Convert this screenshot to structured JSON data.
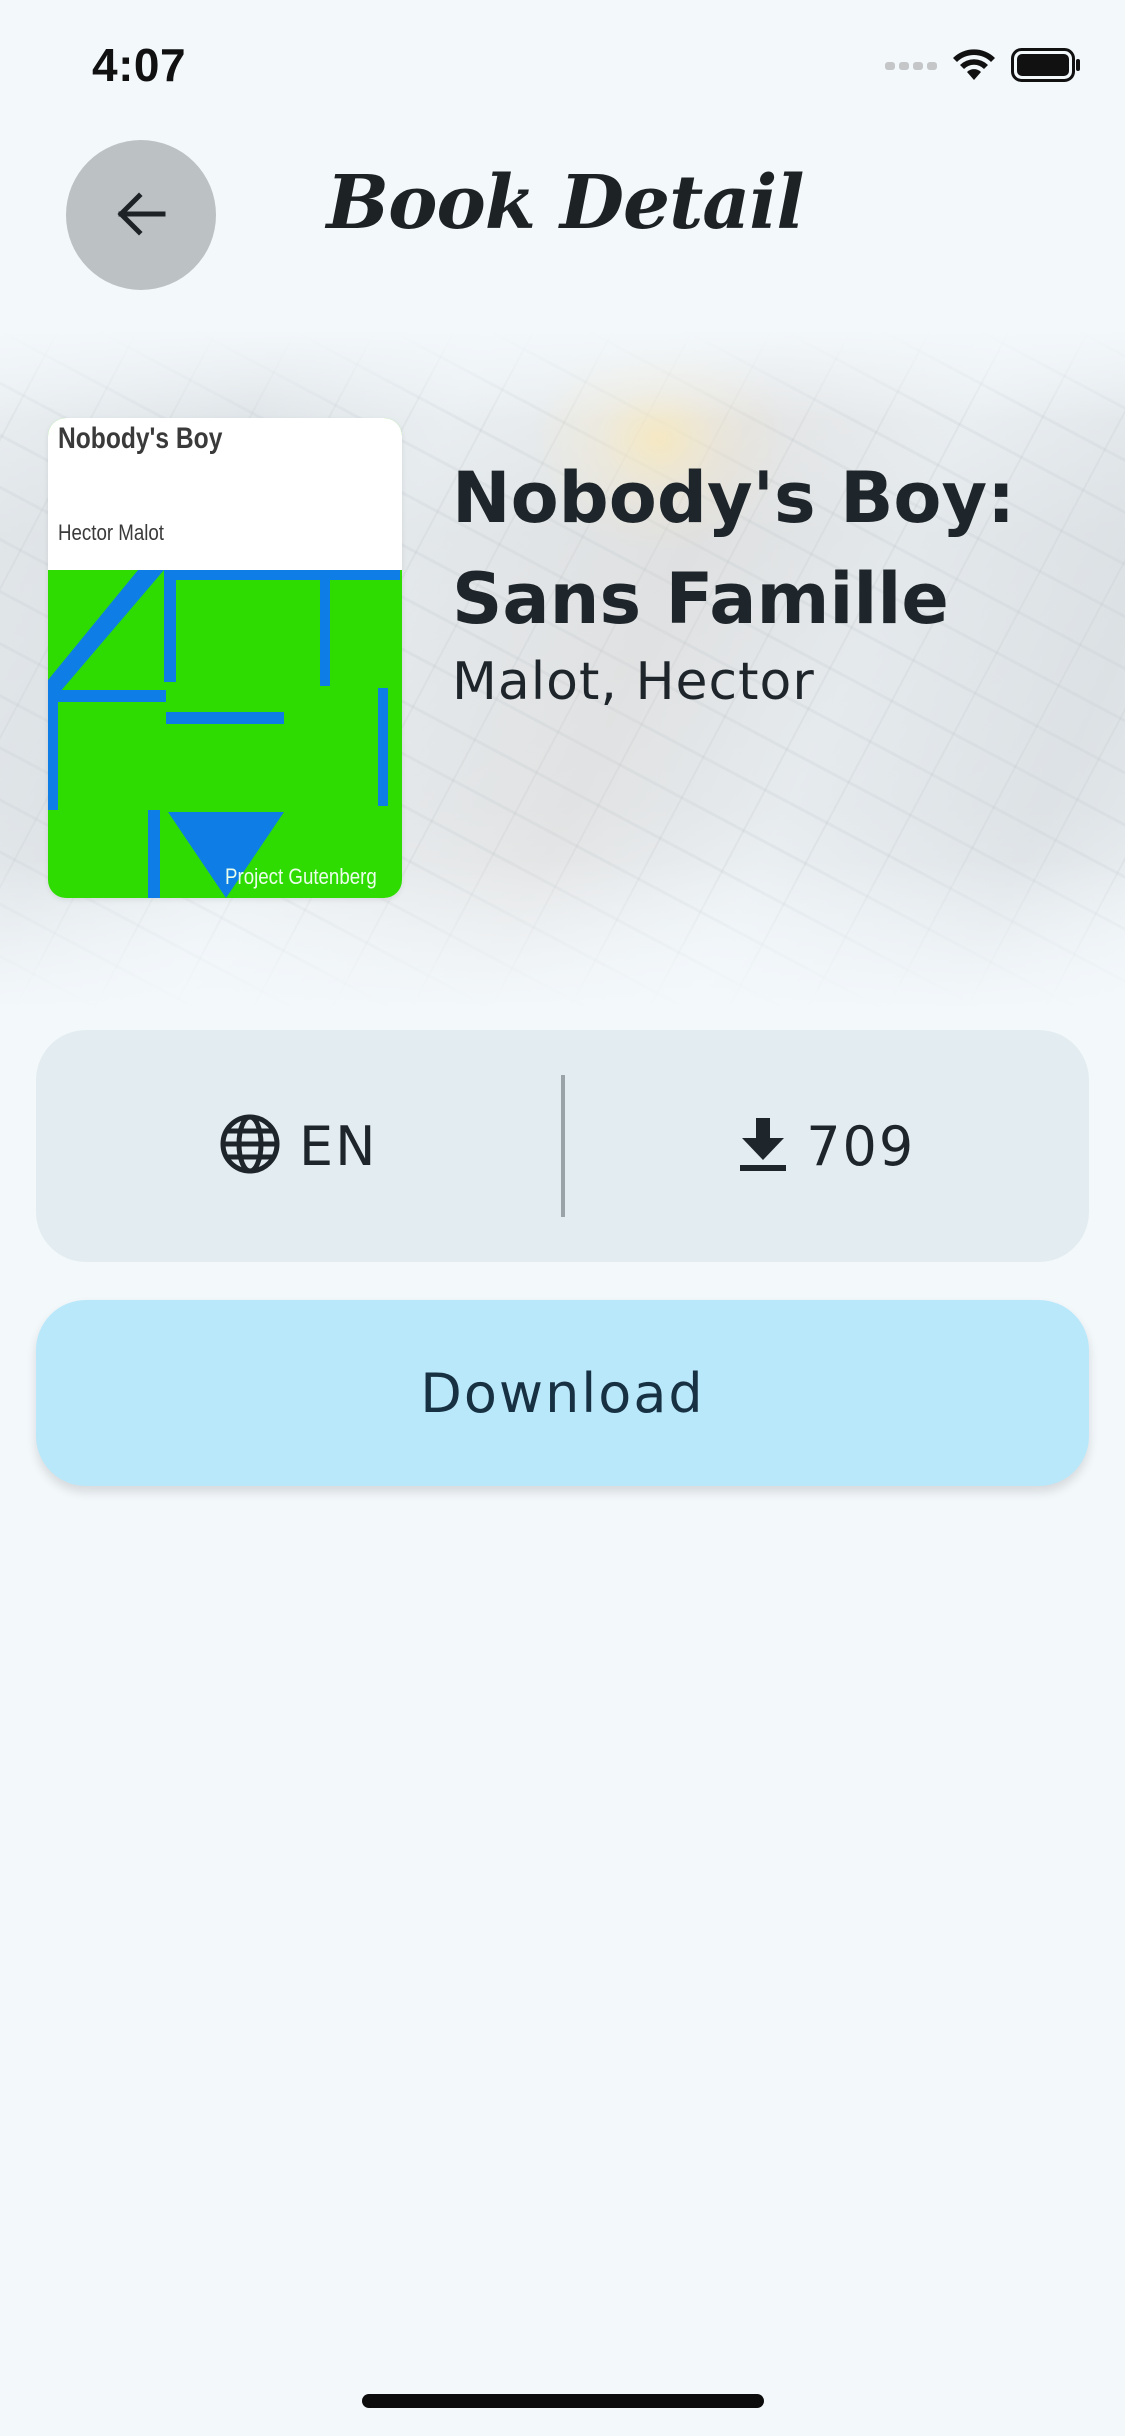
{
  "status_bar": {
    "time": "4:07"
  },
  "header": {
    "title": "Book Detail",
    "back_icon": "arrow-left-icon"
  },
  "book": {
    "title": "Nobody's Boy: Sans Famille",
    "author": "Malot, Hector",
    "cover": {
      "title": "Nobody's Boy",
      "author": "Hector Malot",
      "publisher": "Project Gutenberg",
      "background_color": "#2fdc02",
      "art_color": "#0f7de6"
    }
  },
  "info": {
    "language_icon": "globe-icon",
    "language": "EN",
    "downloads_icon": "download-icon",
    "downloads": "709"
  },
  "actions": {
    "download_label": "Download",
    "download_color": "#bae8fb"
  },
  "colors": {
    "background": "#f3f8fb",
    "card": "#e3edf1",
    "back_button": "#bcc1c4"
  }
}
